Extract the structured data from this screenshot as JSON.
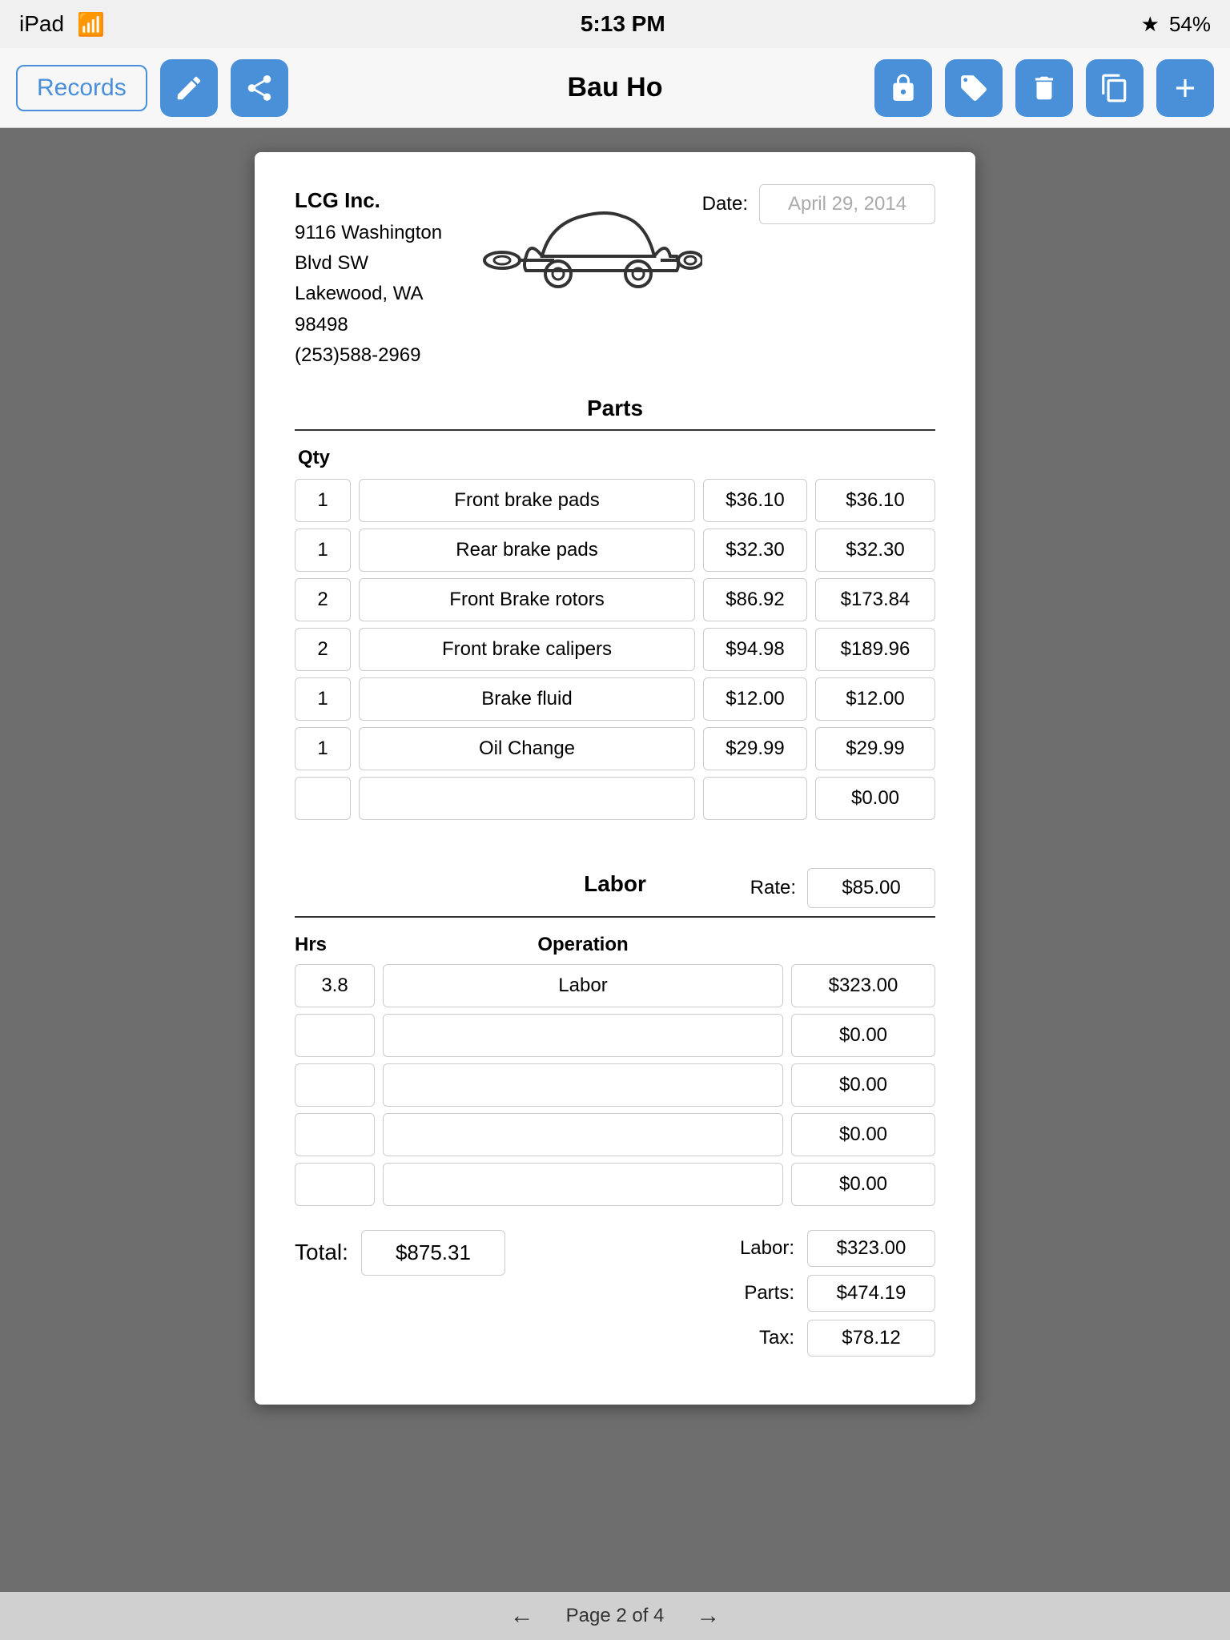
{
  "status_bar": {
    "left": "iPad",
    "wifi": "wifi",
    "time": "5:13 PM",
    "bluetooth": "bluetooth",
    "battery": "54%"
  },
  "toolbar": {
    "records_label": "Records",
    "title": "Bau Ho"
  },
  "document": {
    "company": {
      "name": "LCG Inc.",
      "address1": "9116 Washington Blvd SW",
      "address2": "Lakewood, WA  98498",
      "phone": "(253)588-2969"
    },
    "date_label": "Date:",
    "date_value": "April 29, 2014",
    "parts_section": {
      "title": "Parts",
      "qty_header": "Qty",
      "rows": [
        {
          "qty": "1",
          "desc": "Front brake pads",
          "unit_price": "$36.10",
          "total": "$36.10"
        },
        {
          "qty": "1",
          "desc": "Rear brake pads",
          "unit_price": "$32.30",
          "total": "$32.30"
        },
        {
          "qty": "2",
          "desc": "Front Brake rotors",
          "unit_price": "$86.92",
          "total": "$173.84"
        },
        {
          "qty": "2",
          "desc": "Front brake calipers",
          "unit_price": "$94.98",
          "total": "$189.96"
        },
        {
          "qty": "1",
          "desc": "Brake fluid",
          "unit_price": "$12.00",
          "total": "$12.00"
        },
        {
          "qty": "1",
          "desc": "Oil Change",
          "unit_price": "$29.99",
          "total": "$29.99"
        },
        {
          "qty": "",
          "desc": "",
          "unit_price": "",
          "total": "$0.00"
        }
      ]
    },
    "labor_section": {
      "title": "Labor",
      "rate_label": "Rate:",
      "rate_value": "$85.00",
      "hrs_header": "Hrs",
      "op_header": "Operation",
      "rows": [
        {
          "hrs": "3.8",
          "operation": "Labor",
          "total": "$323.00"
        },
        {
          "hrs": "",
          "operation": "",
          "total": "$0.00"
        },
        {
          "hrs": "",
          "operation": "",
          "total": "$0.00"
        },
        {
          "hrs": "",
          "operation": "",
          "total": "$0.00"
        },
        {
          "hrs": "",
          "operation": "",
          "total": "$0.00"
        }
      ]
    },
    "summary": {
      "total_label": "Total:",
      "total_value": "$875.31",
      "labor_label": "Labor:",
      "labor_value": "$323.00",
      "parts_label": "Parts:",
      "parts_value": "$474.19",
      "tax_label": "Tax:",
      "tax_value": "$78.12"
    }
  },
  "bottom_nav": {
    "page_text": "Page 2 of 4",
    "prev_arrow": "←",
    "next_arrow": "→"
  }
}
